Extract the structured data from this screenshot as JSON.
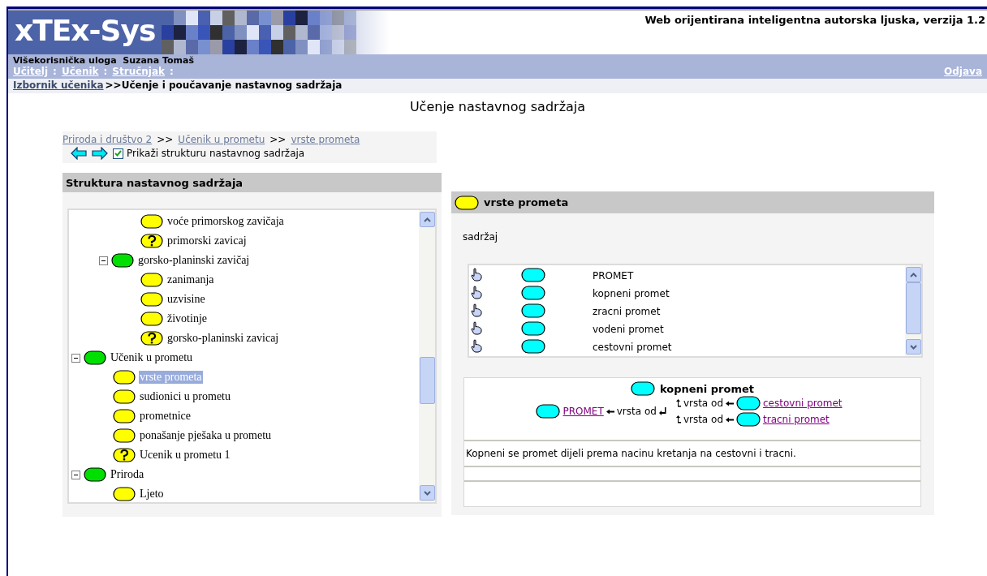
{
  "header": {
    "logo": "xTEx-Sys",
    "tagline": "Web orijentirana inteligentna autorska ljuska, verzija 1.2"
  },
  "user_bar": {
    "role_label": "Višekorisnička uloga",
    "user": "Suzana Tomaš",
    "roles": [
      "Učitelj",
      "Učenik",
      "Stručnjak"
    ],
    "role_separator": ":",
    "logout": "Odjava"
  },
  "breadcrumb": {
    "link": "Izbornik učenika",
    "current": ">>Učenje i poučavanje nastavnog sadržaja"
  },
  "page_title": "Učenje nastavnog sadržaja",
  "nav": {
    "path": [
      {
        "label": "Priroda i društvo 2"
      },
      {
        "label": "Učenik u prometu"
      },
      {
        "label": "vrste prometa"
      }
    ],
    "separator": ">>",
    "show_structure": {
      "label": "Prikaži strukturu nastavnog sadržaja",
      "checked": true
    }
  },
  "tree": {
    "title": "Struktura nastavnog sadržaja",
    "items": [
      {
        "children": [
          {
            "children": [
              {
                "label": "voće primorskog zavičaja",
                "kind": "concept",
                "selected": false
              },
              {
                "label": "primorski zavicaj",
                "kind": "question",
                "selected": false
              }
            ]
          },
          {
            "label": "gorsko-planinski zavičaj",
            "kind": "unit",
            "expanded": true,
            "selected": false,
            "children": [
              {
                "label": "zanimanja",
                "kind": "concept",
                "selected": false
              },
              {
                "label": "uzvisine",
                "kind": "concept",
                "selected": false
              },
              {
                "label": "životinje",
                "kind": "concept",
                "selected": false
              },
              {
                "label": "gorsko-planinski zavicaj",
                "kind": "question",
                "selected": false
              }
            ]
          }
        ]
      },
      {
        "label": "Učenik u prometu",
        "kind": "unit",
        "expanded": true,
        "selected": false,
        "children": [
          {
            "label": "vrste prometa",
            "kind": "concept",
            "selected": true
          },
          {
            "label": "sudionici u prometu",
            "kind": "concept",
            "selected": false
          },
          {
            "label": "prometnice",
            "kind": "concept",
            "selected": false
          },
          {
            "label": "ponašanje pješaka u prometu",
            "kind": "concept",
            "selected": false
          },
          {
            "label": "Ucenik u prometu 1",
            "kind": "question",
            "selected": false
          }
        ]
      },
      {
        "label": "Priroda",
        "kind": "unit",
        "expanded": true,
        "selected": false,
        "children": [
          {
            "label": "Ljeto",
            "kind": "concept",
            "selected": false
          }
        ]
      }
    ]
  },
  "detail": {
    "title": "vrste prometa",
    "section": "sadržaj",
    "concepts": [
      {
        "label": "PROMET"
      },
      {
        "label": "kopneni promet"
      },
      {
        "label": "zracni promet"
      },
      {
        "label": "vodeni promet"
      },
      {
        "label": "cestovni promet"
      }
    ],
    "map": {
      "concept": "kopneni promet",
      "parent": {
        "label": "PROMET",
        "relation": "vrsta od"
      },
      "children": [
        {
          "label": "cestovni promet",
          "relation": "vrsta od"
        },
        {
          "label": "tracni promet",
          "relation": "vrsta od"
        }
      ]
    },
    "description": "Kopneni se promet dijeli prema nacinu kretanja na cestovni i tracni."
  }
}
